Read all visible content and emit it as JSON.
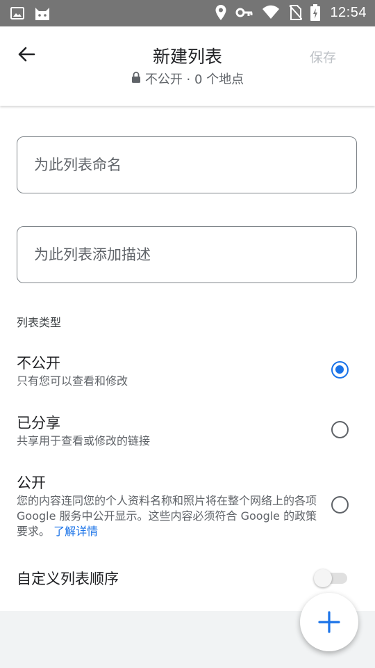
{
  "status_bar": {
    "time": "12:54",
    "left_icons": [
      "image-icon",
      "cat-notification-icon"
    ],
    "right_icons": [
      "location-icon",
      "key-icon",
      "wifi-icon",
      "no-sim-icon",
      "battery-charging-icon"
    ]
  },
  "header": {
    "title": "新建列表",
    "subtitle": "不公开 · 0 个地点",
    "save_label": "保存"
  },
  "form": {
    "name_placeholder": "为此列表命名",
    "description_placeholder": "为此列表添加描述"
  },
  "list_type": {
    "label": "列表类型",
    "options": [
      {
        "title": "不公开",
        "description": "只有您可以查看和修改",
        "selected": true
      },
      {
        "title": "已分享",
        "description": "共享用于查看或修改的链接",
        "selected": false
      },
      {
        "title": "公开",
        "description": "您的内容连同您的个人资料名称和照片将在整个网络上的各项 Google 服务中公开显示。这些内容必须符合 Google 的政策要求。",
        "link": "了解详情",
        "selected": false
      }
    ]
  },
  "custom_order": {
    "label": "自定义列表顺序",
    "enabled": false
  },
  "colors": {
    "accent": "#1a73e8",
    "status_bar": "#757575"
  }
}
